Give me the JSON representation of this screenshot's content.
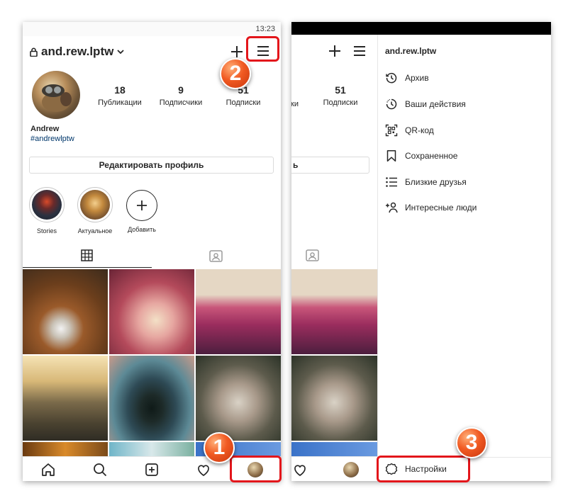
{
  "status_bar": {
    "time": "13:23"
  },
  "profile": {
    "username": "and.rew.lptw",
    "name": "Andrew",
    "hashtag": "#andrewlptw",
    "stats": [
      {
        "value": "18",
        "label": "Публикации"
      },
      {
        "value": "9",
        "label": "Подписчики"
      },
      {
        "value": "51",
        "label": "Подписки"
      }
    ],
    "edit_button": "Редактировать профиль"
  },
  "stories": [
    {
      "label": "Stories"
    },
    {
      "label": "Актуальное"
    },
    {
      "label": "Добавить"
    }
  ],
  "right_strip": {
    "stat_value": "51",
    "stat_label": "Подписки",
    "stat_label_partial": "ки",
    "edit_fragment": "ь"
  },
  "menu": {
    "username": "and.rew.lptw",
    "items": [
      {
        "label": "Архив",
        "icon": "archive-icon"
      },
      {
        "label": "Ваши действия",
        "icon": "activity-icon"
      },
      {
        "label": "QR-код",
        "icon": "qr-code-icon"
      },
      {
        "label": "Сохраненное",
        "icon": "bookmark-icon"
      },
      {
        "label": "Близкие друзья",
        "icon": "close-friends-icon"
      },
      {
        "label": "Интересные люди",
        "icon": "discover-people-icon"
      }
    ],
    "settings": "Настройки"
  },
  "callouts": [
    "1",
    "2",
    "3"
  ],
  "colors": {
    "callout_red": "#e3161b",
    "callout_orange": "#f15a22",
    "link": "#00376b"
  }
}
